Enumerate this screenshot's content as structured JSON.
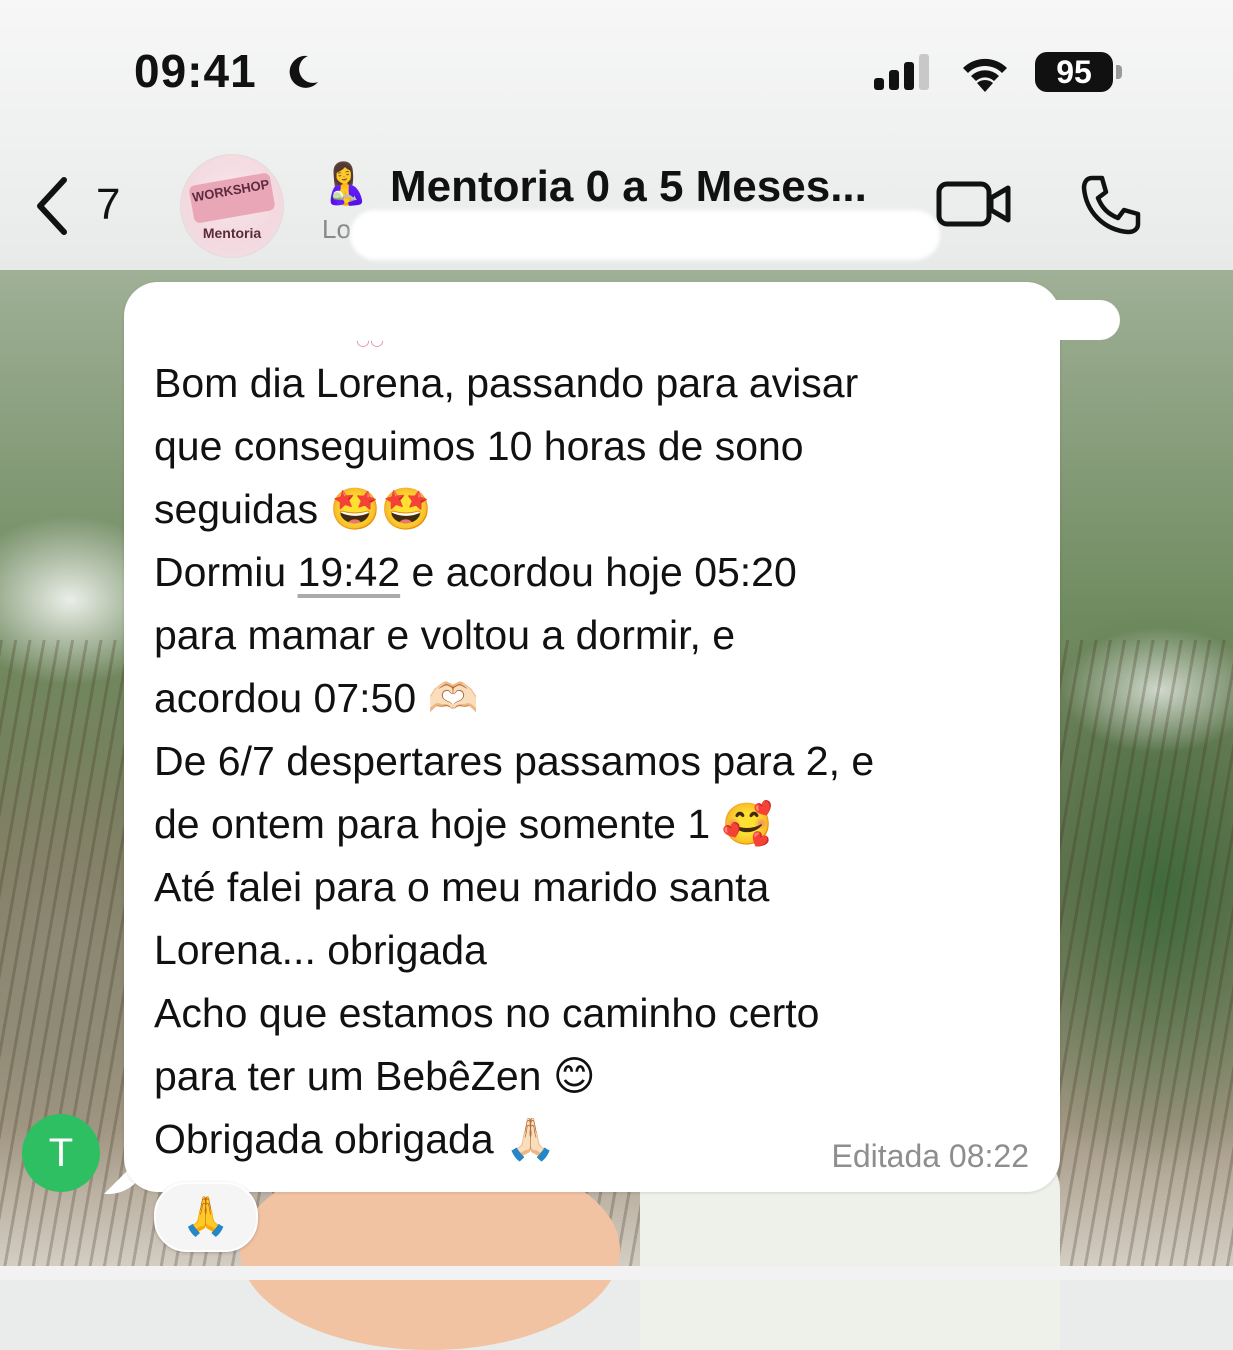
{
  "status_bar": {
    "time": "09:41",
    "battery": "95"
  },
  "header": {
    "back_count": "7",
    "avatar_banner": "WORKSHOP",
    "avatar_label": "Mentoria",
    "title_emoji": "🤱",
    "title": "Mentoria 0 a 5 Meses...",
    "subtitle": "Lo"
  },
  "message": {
    "sender_initial": "T",
    "lines": {
      "l1": "Bom dia Lorena, passando para avisar",
      "l2": "que conseguimos 10 horas de sono",
      "l3": "seguidas 🤩🤩",
      "l4_a": "Dormiu ",
      "l4_time": "19:42",
      "l4_b": " e acordou hoje 05:20",
      "l5": "para mamar e voltou a dormir, e",
      "l6": "acordou 07:50 🫶🏻",
      "l7": "De 6/7 despertares passamos para 2, e",
      "l8": "de ontem para hoje somente 1 🥰",
      "l9": "Até falei para o meu marido santa",
      "l10": "Lorena... obrigada",
      "l11": "Acho que estamos no caminho certo",
      "l12": "para ter um BebêZen 😊",
      "l13": "Obrigada obrigada 🙏🏻"
    },
    "edited_label": "Editada 08:22",
    "reaction": "🙏"
  },
  "colors": {
    "sender_avatar": "#2ebf63",
    "bubble": "#ffffff",
    "header_bg": "#f2f3f2"
  }
}
